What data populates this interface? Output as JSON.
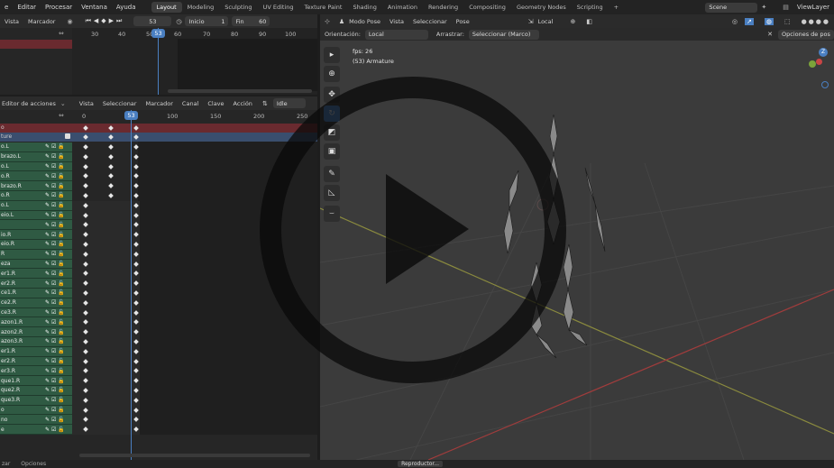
{
  "menu": [
    "e",
    "Editar",
    "Procesar",
    "Ventana",
    "Ayuda"
  ],
  "workspaces": [
    "Layout",
    "Modeling",
    "Sculpting",
    "UV Editing",
    "Texture Paint",
    "Shading",
    "Animation",
    "Rendering",
    "Compositing",
    "Geometry Nodes",
    "Scripting"
  ],
  "active_workspace": "Layout",
  "add_workspace": "+",
  "scene": {
    "name": "Scene",
    "viewlayer": "ViewLayer"
  },
  "timeline": {
    "menus": [
      "Vista",
      "Marcador"
    ],
    "current_frame": "53",
    "start_label": "Inicio",
    "start": "1",
    "end_label": "Fin",
    "end": "60",
    "ruler": [
      "30",
      "40",
      "50",
      "60",
      "70",
      "80",
      "90",
      "100"
    ],
    "marker": "53"
  },
  "dopesheet": {
    "mode": "Editor de acciones",
    "menus": [
      "Vista",
      "Seleccionar",
      "Marcador",
      "Canal",
      "Clave",
      "Acción"
    ],
    "action": "Idle",
    "ruler": [
      "0",
      "53",
      "100",
      "150",
      "200",
      "250"
    ],
    "summary": "o",
    "object": "ture",
    "channels": [
      "o.L",
      "brazo.L",
      "o.L",
      "o.R",
      "brazo.R",
      "o.R",
      "o.L",
      "eio.L",
      "",
      "io.R",
      "eio.R",
      "R",
      "eza",
      "er1.R",
      "er2.R",
      "ce1.R",
      "ce2.R",
      "ce3.R",
      "azon1.R",
      "azon2.R",
      "azon3.R",
      "er1.R",
      "er2.R",
      "er3.R",
      "que1.R",
      "que2.R",
      "que3.R",
      "o",
      "no",
      "e"
    ]
  },
  "viewport": {
    "mode": "Modo Pose",
    "menus": [
      "Vista",
      "Seleccionar",
      "Pose"
    ],
    "orientation_global": "Local",
    "orientation_label": "Orientación:",
    "orientation": "Local",
    "drag_label": "Arrastrar:",
    "drag": "Seleccionar (Marco)",
    "options": "Opciones de pos",
    "fps": "fps: 26",
    "object_info": "(53) Armature",
    "gizmo": {
      "z": "Z",
      "y": "Y"
    }
  },
  "status": {
    "left": "zar",
    "options": "Opciones",
    "player": "Reproductor..."
  },
  "colors": {
    "accent": "#4a7fc1",
    "channel": "#2f5a43",
    "active_row": "#3a4e6e",
    "selected": "#6a2a2f"
  },
  "video_overlay": "play-button"
}
